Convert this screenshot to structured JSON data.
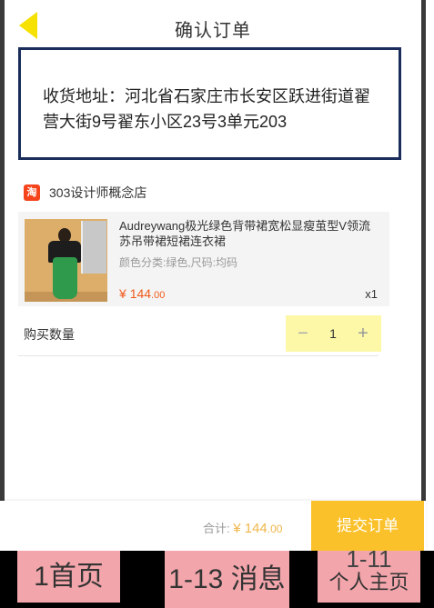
{
  "header": {
    "title": "确认订单"
  },
  "address": {
    "text": "收货地址：河北省石家庄市长安区跃进街道翟营大街9号翟东小区23号3单元203"
  },
  "store": {
    "icon_text": "淘",
    "name": "303设计师概念店"
  },
  "product": {
    "name": "Audreywang极光绿色背带裙宽松显瘦茧型V领流苏吊带裙短裙连衣裙",
    "spec": "颜色分类:绿色,尺码:均码",
    "price_prefix": "¥ ",
    "price_main": "144",
    "price_decimal": ".00",
    "quantity": "x1"
  },
  "quantity_row": {
    "label": "购买数量",
    "minus": "−",
    "value": "1",
    "plus": "+"
  },
  "footer": {
    "total_label": "合计: ",
    "total_prefix": "¥ ",
    "total_main": "144",
    "total_decimal": ".00",
    "submit_label": "提交订单"
  },
  "tabbar": {
    "tab1": "1首页",
    "tab2": "1-13 消息",
    "tab3_line1": "1-11",
    "tab3_line2": "个人主页"
  },
  "colors": {
    "accent": "#fbc12a",
    "price": "#f05a1a",
    "back_arrow": "#f6e100",
    "address_border": "#1a2c5a",
    "tab_bg": "#f2a5ab"
  }
}
